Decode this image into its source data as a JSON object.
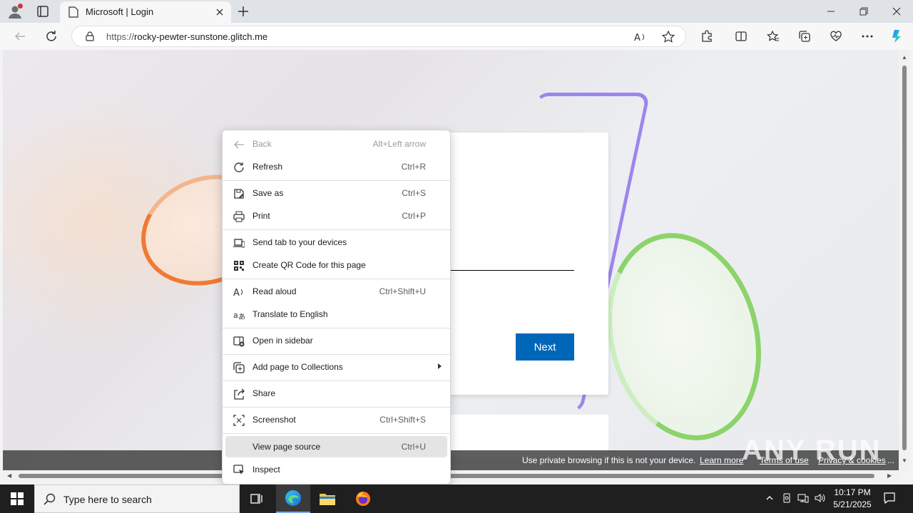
{
  "browser": {
    "tab_title": "Microsoft | Login",
    "url_protocol": "https://",
    "url_host": "rocky-pewter-sunstone.glitch.me"
  },
  "page": {
    "next_label": "Next",
    "footer_message": "Use private browsing if this is not your device.",
    "footer_learn_more": "Learn more",
    "footer_terms": "Terms of use",
    "footer_privacy": "Privacy & cookies",
    "footer_more": "...",
    "watermark": "ANY RUN"
  },
  "context_menu": {
    "items": [
      {
        "label": "Back",
        "shortcut": "Alt+Left arrow",
        "icon": "back-arrow-icon"
      },
      {
        "label": "Refresh",
        "shortcut": "Ctrl+R",
        "icon": "refresh-icon"
      },
      {
        "label": "Save as",
        "shortcut": "Ctrl+S",
        "icon": "save-as-icon"
      },
      {
        "label": "Print",
        "shortcut": "Ctrl+P",
        "icon": "printer-icon"
      },
      {
        "label": "Send tab to your devices",
        "shortcut": "",
        "icon": "devices-icon"
      },
      {
        "label": "Create QR Code for this page",
        "shortcut": "",
        "icon": "qr-code-icon"
      },
      {
        "label": "Read aloud",
        "shortcut": "Ctrl+Shift+U",
        "icon": "read-aloud-icon"
      },
      {
        "label": "Translate to English",
        "shortcut": "",
        "icon": "translate-icon"
      },
      {
        "label": "Open in sidebar",
        "shortcut": "",
        "icon": "sidebar-icon"
      },
      {
        "label": "Add page to Collections",
        "shortcut": "",
        "icon": "collections-icon"
      },
      {
        "label": "Share",
        "shortcut": "",
        "icon": "share-icon"
      },
      {
        "label": "Screenshot",
        "shortcut": "Ctrl+Shift+S",
        "icon": "screenshot-icon"
      },
      {
        "label": "View page source",
        "shortcut": "Ctrl+U",
        "icon": ""
      },
      {
        "label": "Inspect",
        "shortcut": "",
        "icon": "inspect-icon"
      }
    ]
  },
  "taskbar": {
    "search_placeholder": "Type here to search",
    "time": "10:17 PM",
    "date": "5/21/2025"
  },
  "colors": {
    "accent": "#0067b8",
    "menu_hover": "#e4e4e4",
    "taskbar": "#1f1f1f"
  }
}
